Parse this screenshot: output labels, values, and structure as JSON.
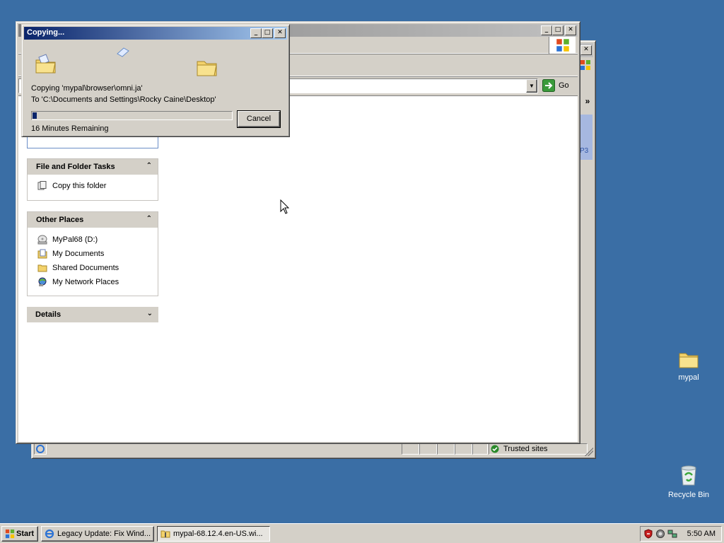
{
  "desktop": {
    "icons": [
      {
        "label": "mypal",
        "icon": "folder-icon"
      },
      {
        "label": "Recycle Bin",
        "icon": "recycle-bin-icon"
      }
    ]
  },
  "explorer": {
    "go_label": "Go",
    "chevron": "»",
    "partial_sidebar_text": "P3",
    "status": {
      "zone": "Trusted sites"
    },
    "file_folder_tasks": {
      "title": "File and Folder Tasks",
      "items": [
        {
          "label": "Copy this folder",
          "icon": "copy-folder-icon"
        }
      ]
    },
    "other_places": {
      "title": "Other Places",
      "items": [
        {
          "label": "MyPal68 (D:)",
          "icon": "drive-icon"
        },
        {
          "label": "My Documents",
          "icon": "my-documents-icon"
        },
        {
          "label": "Shared Documents",
          "icon": "shared-folder-icon"
        },
        {
          "label": "My Network Places",
          "icon": "network-places-icon"
        }
      ]
    },
    "details": {
      "title": "Details"
    }
  },
  "copy_dialog": {
    "title": "Copying...",
    "line1": "Copying 'mypal\\browser\\omni.ja'",
    "line2": "To 'C:\\Documents and Settings\\Rocky Caine\\Desktop'",
    "progress_fraction": 0.02,
    "remaining": "16 Minutes Remaining",
    "cancel_label": "Cancel"
  },
  "taskbar": {
    "start_label": "Start",
    "buttons": [
      {
        "label": "Legacy Update: Fix Wind...",
        "icon": "ie-icon"
      },
      {
        "label": "mypal-68.12.4.en-US.wi...",
        "icon": "folder-zip-icon"
      }
    ],
    "clock": "5:50 AM",
    "tray_icons": [
      "shield-icon",
      "security-icon",
      "network-icon"
    ]
  },
  "colors": {
    "desktop": "#3a6ea5",
    "title_active": "#0a246a",
    "title_inactive": "#808080",
    "face": "#d4d0c8"
  }
}
